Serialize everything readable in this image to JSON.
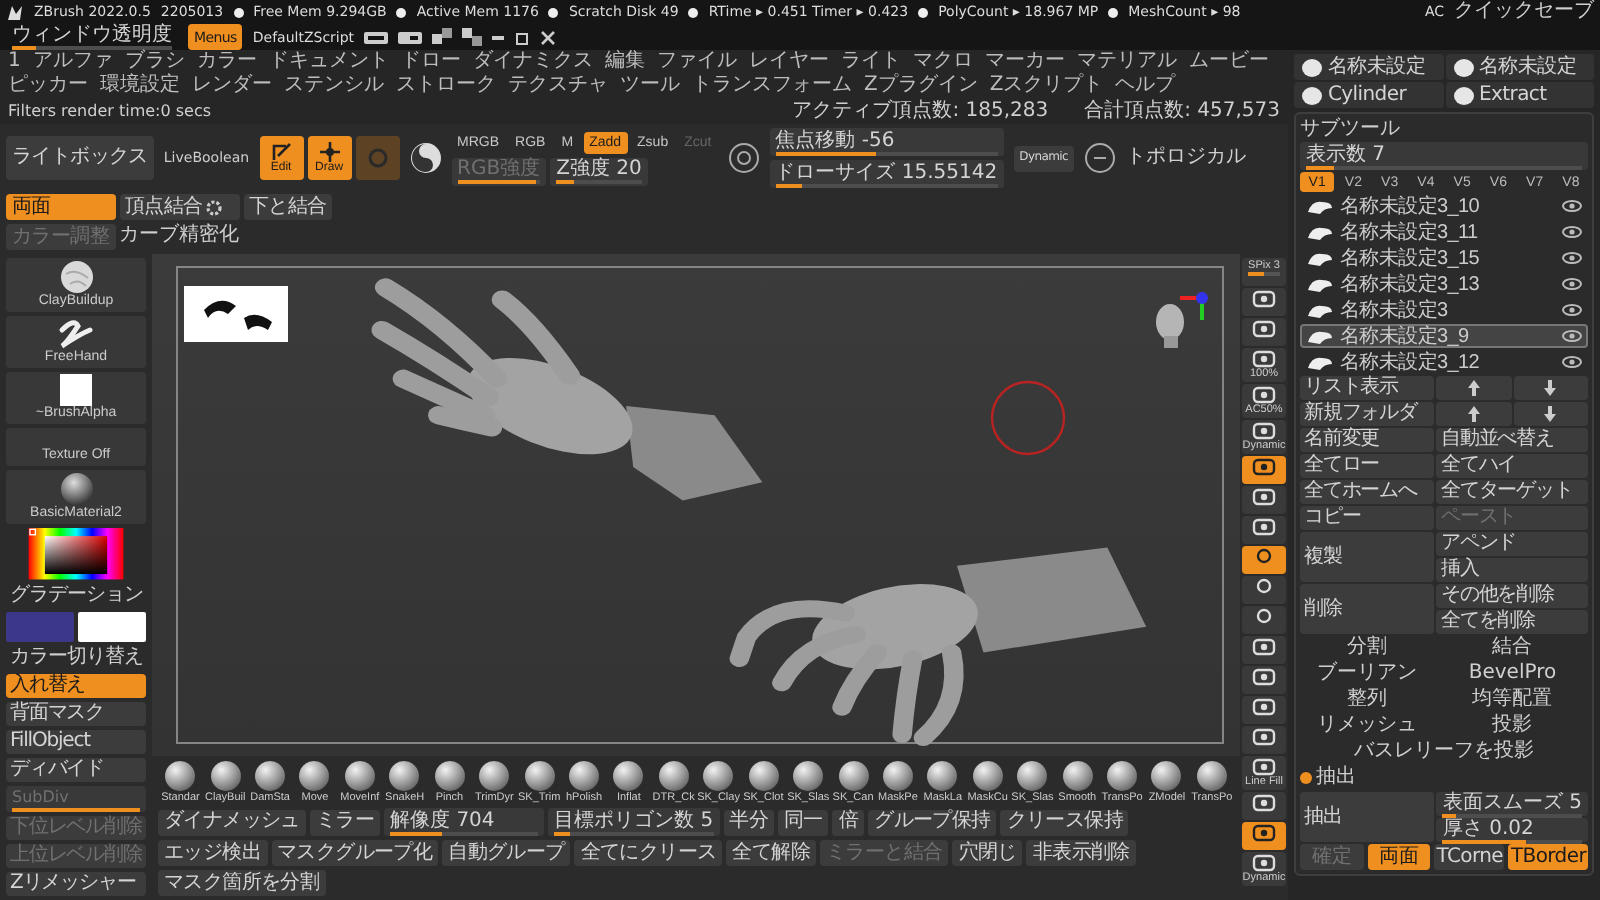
{
  "title_bar": {
    "app": "ZBrush 2022.0.5",
    "build": "2205013",
    "stats": [
      "Free Mem 9.294GB",
      "Active Mem 1176",
      "Scratch Disk 49",
      "RTime ▸ 0.451 Timer ▸ 0.423",
      "PolyCount ▸ 18.967 MP",
      "MeshCount ▸ 98"
    ],
    "right": [
      {
        "label": "AC",
        "kind": "text"
      },
      {
        "label": "クイックセーブ",
        "kind": "button"
      },
      {
        "label": "ウィンドウ透明度",
        "kind": "slider",
        "level": 0.15
      },
      {
        "label": "Menus",
        "kind": "toggle",
        "on": true
      },
      {
        "label": "DefaultZScript",
        "kind": "text"
      }
    ]
  },
  "menu": [
    "1",
    "アルファ",
    "ブラシ",
    "カラー",
    "ドキュメント",
    "ドロー",
    "ダイナミクス",
    "編集",
    "ファイル",
    "レイヤー",
    "ライト",
    "マクロ",
    "マーカー",
    "マテリアル",
    "ムービー",
    "ピッカー",
    "環境設定",
    "レンダー",
    "ステンシル",
    "ストローク",
    "テクスチャ",
    "ツール",
    "トランスフォーム",
    "Zプラグイン",
    "Zスクリプト",
    "ヘルプ"
  ],
  "status": {
    "text": "Filters render time:0 secs",
    "counts": [
      "アクティブ頂点数: 185,283",
      "合計頂点数: 457,573"
    ]
  },
  "shelf": {
    "lightbox": "ライトボックス",
    "live_boolean": "LiveBoolean",
    "modes": [
      {
        "label": "Edit",
        "selected": true
      },
      {
        "label": "Draw",
        "selected": true
      },
      {
        "selected": false
      }
    ],
    "channels": [
      {
        "label": "MRGB",
        "selected": false,
        "disabled": false
      },
      {
        "label": "RGB",
        "selected": false,
        "disabled": false
      },
      {
        "label": "M",
        "selected": false,
        "disabled": false
      },
      {
        "label": "Zadd",
        "selected": true,
        "disabled": false
      },
      {
        "label": "Zsub",
        "selected": false,
        "disabled": false
      },
      {
        "label": "Zcut",
        "selected": false,
        "disabled": true
      }
    ],
    "channel_sliders": [
      {
        "label": "RGB強度",
        "level": 0.95,
        "disabled": true
      },
      {
        "label": "Z強度 20",
        "level": 0.2,
        "disabled": false
      }
    ],
    "focal_sliders": [
      {
        "label": "焦点移動 -56",
        "level": 0.45
      },
      {
        "label": "ドローサイズ 15.55142",
        "level": 0.12
      }
    ],
    "dynamic": "Dynamic",
    "topological": "トポロジカル",
    "options": [
      {
        "label": "両面",
        "kind": "button",
        "on": true,
        "disabled": false
      },
      {
        "label": "頂点結合",
        "kind": "settings",
        "on": false,
        "disabled": false
      },
      {
        "label": "下と結合",
        "kind": "button",
        "on": false,
        "disabled": false
      },
      {
        "label": "カラー調整",
        "kind": "button",
        "on": false,
        "disabled": true
      },
      {
        "label": "カーブ精密化",
        "kind": "plain",
        "on": false,
        "disabled": false
      }
    ]
  },
  "left_panel": {
    "thumbnails": [
      {
        "label": "ClayBuildup",
        "kind": "sphere"
      },
      {
        "label": "FreeHand",
        "kind": "stroke"
      },
      {
        "label": "~BrushAlpha",
        "kind": "alpha"
      },
      {
        "label": "Texture Off",
        "kind": "empty"
      },
      {
        "label": "BasicMaterial2",
        "kind": "material"
      }
    ],
    "gradient": "グラデーション",
    "swatches": [
      {
        "color": "#3b3889"
      },
      {
        "color": "#ffffff"
      }
    ],
    "switch": "カラー切り替え",
    "buttons": [
      {
        "label": "入れ替え",
        "kind": "button",
        "on": true,
        "disabled": false
      },
      {
        "label": "背面マスク",
        "kind": "button",
        "on": false,
        "disabled": false
      },
      {
        "label": "FillObject",
        "kind": "button",
        "on": false,
        "disabled": false
      },
      {
        "label": "ディバイド",
        "kind": "tall",
        "on": false,
        "disabled": false
      },
      {
        "label": "SubDiv",
        "kind": "slider",
        "level": 1,
        "disabled": true
      },
      {
        "label": "下位レベル削除",
        "kind": "button",
        "on": false,
        "disabled": true
      },
      {
        "label": "上位レベル削除",
        "kind": "button",
        "on": false,
        "disabled": true
      },
      {
        "label": "Zリメッシャー",
        "kind": "tall",
        "on": false,
        "disabled": false
      }
    ]
  },
  "view_tools": [
    {
      "label": "SPix 3",
      "kind": "slider",
      "level": 0.5,
      "on": false
    },
    {
      "kind": "icon",
      "on": false
    },
    {
      "kind": "icon",
      "on": false
    },
    {
      "label": "100%",
      "kind": "icon",
      "on": false
    },
    {
      "label": "AC50%",
      "kind": "icon",
      "on": false
    },
    {
      "label": "Dynamic",
      "kind": "icon",
      "on": false
    },
    {
      "kind": "icon",
      "on": true
    },
    {
      "kind": "icon",
      "on": false
    },
    {
      "kind": "icon",
      "on": false
    },
    {
      "kind": "small",
      "on": true
    },
    {
      "kind": "small",
      "on": false
    },
    {
      "kind": "small",
      "on": false
    },
    {
      "kind": "icon",
      "on": false
    },
    {
      "kind": "icon",
      "on": false
    },
    {
      "kind": "icon",
      "on": false
    },
    {
      "kind": "icon",
      "on": false
    },
    {
      "label": "Line Fill",
      "kind": "icon",
      "on": false
    },
    {
      "kind": "icon",
      "on": false
    },
    {
      "kind": "icon",
      "on": true
    },
    {
      "label": "Dynamic",
      "kind": "icon",
      "on": false
    }
  ],
  "tool_thumbs": [
    "名称未設定",
    "名称未設定",
    "Cylinder",
    "Extract"
  ],
  "subtool": {
    "title": "サブツール",
    "visible": {
      "label": "表示数 7",
      "level": 0.1
    },
    "versions": [
      {
        "label": "V1",
        "selected": true
      },
      {
        "label": "V2",
        "selected": false
      },
      {
        "label": "V3",
        "selected": false
      },
      {
        "label": "V4",
        "selected": false
      },
      {
        "label": "V5",
        "selected": false
      },
      {
        "label": "V6",
        "selected": false
      },
      {
        "label": "V7",
        "selected": false
      },
      {
        "label": "V8",
        "selected": false
      }
    ],
    "items": [
      {
        "name": "名称未設定3_10",
        "selected": false
      },
      {
        "name": "名称未設定3_11",
        "selected": false
      },
      {
        "name": "名称未設定3_15",
        "selected": false
      },
      {
        "name": "名称未設定3_13",
        "selected": false
      },
      {
        "name": "名称未設定3",
        "selected": false
      },
      {
        "name": "名称未設定3_9",
        "selected": true
      },
      {
        "name": "名称未設定3_12",
        "selected": false
      }
    ],
    "buttons": [
      {
        "label": "リスト表示",
        "kind": "button",
        "disabled": false
      },
      {
        "kind": "arrows",
        "disabled": false
      },
      {
        "label": "新規フォルダ",
        "kind": "button",
        "disabled": false
      },
      {
        "kind": "arrows",
        "disabled": false
      },
      {
        "label": "名前変更",
        "kind": "button",
        "disabled": false
      },
      {
        "label": "自動並べ替え",
        "kind": "button",
        "disabled": false
      },
      {
        "label": "全てロー",
        "kind": "button",
        "disabled": false
      },
      {
        "label": "全てハイ",
        "kind": "button",
        "disabled": false
      },
      {
        "label": "全てホームへ",
        "kind": "button",
        "disabled": false
      },
      {
        "label": "全てターゲット",
        "kind": "button",
        "disabled": false
      },
      {
        "label": "コピー",
        "kind": "button",
        "disabled": false
      },
      {
        "label": "ペースト",
        "kind": "button",
        "disabled": true
      },
      {
        "label": "複製",
        "kind": "tall",
        "disabled": false
      },
      {
        "label": "アペンド",
        "kind": "button",
        "disabled": false
      },
      {
        "label": "挿入",
        "kind": "button",
        "disabled": false
      },
      {
        "label": "削除",
        "kind": "tall",
        "disabled": false
      },
      {
        "label": "その他を削除",
        "kind": "button",
        "disabled": false
      },
      {
        "label": "全てを削除",
        "kind": "button",
        "disabled": false
      },
      {
        "label": "分割",
        "kind": "plain",
        "disabled": false
      },
      {
        "label": "結合",
        "kind": "plain",
        "disabled": false
      },
      {
        "label": "ブーリアン",
        "kind": "plain",
        "disabled": false
      },
      {
        "label": "BevelPro",
        "kind": "plain",
        "disabled": false
      },
      {
        "label": "整列",
        "kind": "plain",
        "disabled": false
      },
      {
        "label": "均等配置",
        "kind": "plain",
        "disabled": false
      },
      {
        "label": "リメッシュ",
        "kind": "plain",
        "disabled": false
      },
      {
        "label": "投影",
        "kind": "plain",
        "disabled": false
      },
      {
        "label": "バスレリーフを投影",
        "kind": "wide",
        "disabled": false
      },
      {
        "label": "抽出",
        "kind": "section",
        "disabled": false
      },
      {
        "label": "抽出",
        "kind": "tall",
        "disabled": false
      },
      {
        "label": "表面スムーズ 5",
        "kind": "slider",
        "level": 0.1,
        "disabled": false
      },
      {
        "label": "厚さ 0.02",
        "kind": "slider",
        "level": 0.6,
        "disabled": false
      }
    ],
    "extract_footer": [
      {
        "label": "確定",
        "on": false,
        "disabled": true
      },
      {
        "label": "両面",
        "on": true,
        "disabled": false
      },
      {
        "label": "TCorne",
        "on": false,
        "disabled": false
      },
      {
        "label": "TBorder",
        "on": true,
        "disabled": false
      }
    ]
  },
  "bottom": {
    "brushes": [
      "Standar",
      "ClayBuil",
      "DamSta",
      "Move",
      "MoveInf",
      "SnakeH",
      "Pinch",
      "TrimDyr",
      "SK_Trim",
      "hPolish",
      "Inflat",
      "DTR_Ck",
      "SK_Clay",
      "SK_Clot",
      "SK_Slas",
      "SK_Can",
      "MaskPe",
      "MaskLa",
      "MaskCu",
      "SK_Slas",
      "Smooth",
      "TransPo",
      "ZModel",
      "TransPo"
    ],
    "dynamesh": "ダイナメッシュ",
    "mirror": "ミラー",
    "resolution": {
      "label": "解像度 704",
      "level": 0.35
    },
    "remesh": [
      {
        "label": "目標ポリゴン数 5",
        "kind": "slider",
        "level": 0.1,
        "disabled": false
      },
      {
        "label": "半分",
        "kind": "button",
        "disabled": false
      },
      {
        "label": "同一",
        "kind": "button",
        "disabled": false
      },
      {
        "label": "倍",
        "kind": "button",
        "disabled": false
      },
      {
        "label": "グループ保持",
        "kind": "button",
        "disabled": false
      },
      {
        "label": "クリース保持",
        "kind": "button",
        "disabled": false
      },
      {
        "label": "エッジ検出",
        "kind": "button",
        "disabled": false
      },
      {
        "label": "マスクグループ化",
        "kind": "button",
        "disabled": false
      },
      {
        "label": "自動グループ",
        "kind": "button",
        "disabled": false
      },
      {
        "label": "全てにクリース",
        "kind": "button",
        "disabled": false
      },
      {
        "label": "全て解除",
        "kind": "button",
        "disabled": false
      },
      {
        "label": "ミラーと結合",
        "kind": "button",
        "disabled": true
      },
      {
        "label": "穴閉じ",
        "kind": "button",
        "disabled": false
      },
      {
        "label": "非表示削除",
        "kind": "button",
        "disabled": false
      },
      {
        "label": "マスク箇所を分割",
        "kind": "button",
        "disabled": false
      }
    ]
  }
}
